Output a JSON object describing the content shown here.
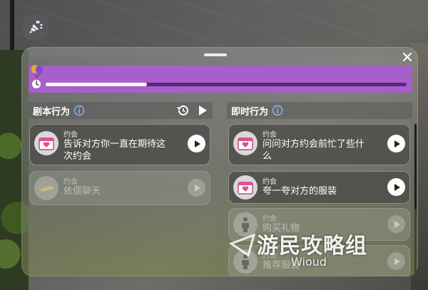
{
  "need": {
    "progress": 0.28,
    "bar_color": "#a95fc9",
    "fill_color": "#ffffff",
    "icons": [
      "balloon-icon",
      "clock-icon"
    ]
  },
  "scripted": {
    "title": "剧本行为",
    "cards": [
      {
        "category": "约会",
        "text_line1": "告诉对方你一直在期待这",
        "text_line2": "次约会",
        "icon": "calendar-heart-icon",
        "enabled": true
      },
      {
        "category": "约会",
        "text_line1": "依偎聊天",
        "text_line2": "",
        "icon": "cuddle-icon",
        "enabled": false
      }
    ]
  },
  "instant": {
    "title": "即时行为",
    "cards": [
      {
        "category": "约会",
        "text_line1": "问问对方约会前忙了些什",
        "text_line2": "么",
        "icon": "calendar-heart-icon",
        "enabled": true
      },
      {
        "category": "约会",
        "text_line1": "夸一夸对方的服装",
        "text_line2": "",
        "icon": "calendar-heart-icon",
        "enabled": true
      },
      {
        "category": "约会",
        "text_line1": "购买礼物",
        "text_line2": "",
        "icon": "person-icon",
        "enabled": false
      },
      {
        "category": "约会",
        "text_line1": "推荐服装",
        "text_line2": "",
        "icon": "person-icon",
        "enabled": false
      }
    ]
  },
  "watermark": {
    "big": "游民攻略组",
    "small": "Wioud"
  }
}
